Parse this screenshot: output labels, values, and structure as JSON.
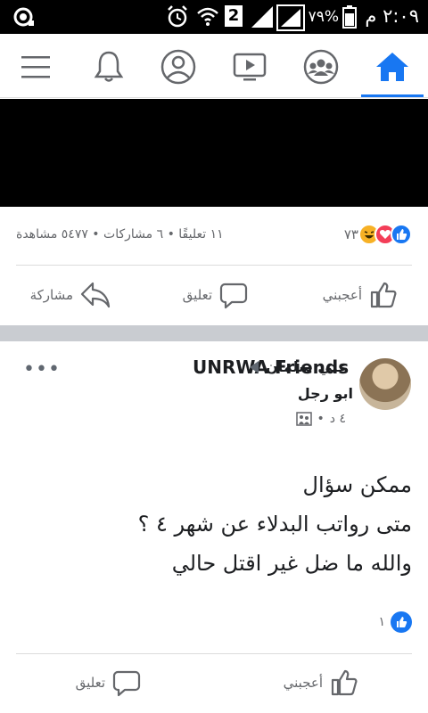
{
  "status_bar": {
    "time": "٢:٠٩ م",
    "battery_percent": "٧٩%",
    "sim_label": "2"
  },
  "nav": {
    "items": [
      "menu-icon",
      "bell-icon",
      "profile-icon",
      "watch-icon",
      "groups-icon",
      "home-icon"
    ],
    "active_color": "#1877f2"
  },
  "video_post": {
    "reaction_count": "٧٣",
    "summary": "١١ تعليقًا • ٦ مشاركات • ٥٤٧٧ مشاهدة",
    "actions": {
      "like": "أعجبني",
      "comment": "تعليق",
      "share": "مشاركة"
    }
  },
  "post": {
    "group_name": "UNRWA Friends",
    "author_first": "علي سلمان",
    "author_second": "ابو رجل",
    "time": "٤ د",
    "text_lines": [
      "ممكن سؤال",
      "متى رواتب البدلاء عن شهر ٤ ؟",
      "والله ما ضل غير اقتل حالي"
    ],
    "like_count": "١",
    "actions": {
      "like": "أعجبني",
      "comment": "تعليق"
    }
  }
}
